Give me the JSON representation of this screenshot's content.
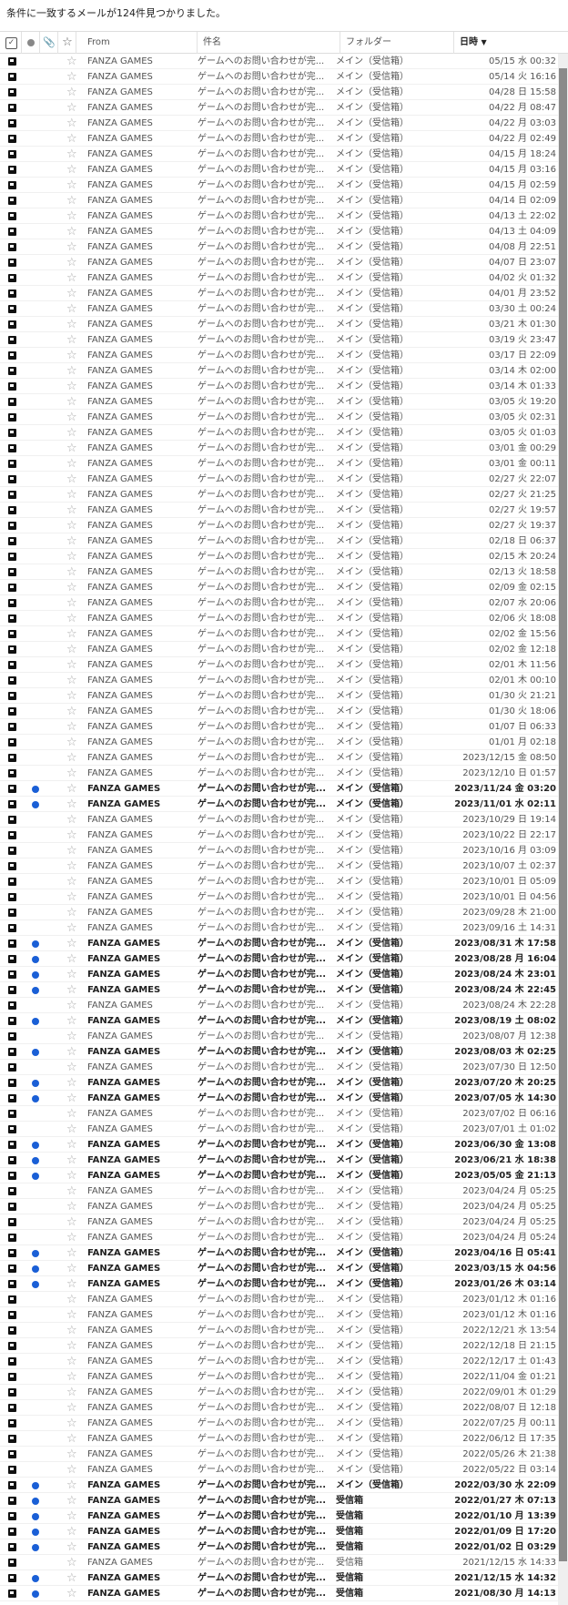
{
  "summary": "条件に一致するメールが124件見つかりました。",
  "header": {
    "select_icon": "checkbox-icon",
    "unread_icon": "unread-dot-icon",
    "attach_icon": "paperclip-icon",
    "star_icon": "star-icon",
    "from": "From",
    "subject": "件名",
    "folder": "フォルダー",
    "date": "日時",
    "sort_indicator": "▼"
  },
  "colors": {
    "unread_dot": "#1a5fd6",
    "flag": "#111111",
    "scrollbar_thumb": "#8a8a8a"
  },
  "rows": [
    {
      "from": "FANZA GAMES",
      "subject": "ゲームへのお問い合わせが完...",
      "folder": "メイン（受信箱）",
      "date": "05/15 水 00:32",
      "unread": false
    },
    {
      "from": "FANZA GAMES",
      "subject": "ゲームへのお問い合わせが完...",
      "folder": "メイン（受信箱）",
      "date": "05/14 火 16:16",
      "unread": false
    },
    {
      "from": "FANZA GAMES",
      "subject": "ゲームへのお問い合わせが完...",
      "folder": "メイン（受信箱）",
      "date": "04/28 日 15:58",
      "unread": false
    },
    {
      "from": "FANZA GAMES",
      "subject": "ゲームへのお問い合わせが完...",
      "folder": "メイン（受信箱）",
      "date": "04/22 月 08:47",
      "unread": false
    },
    {
      "from": "FANZA GAMES",
      "subject": "ゲームへのお問い合わせが完...",
      "folder": "メイン（受信箱）",
      "date": "04/22 月 03:03",
      "unread": false
    },
    {
      "from": "FANZA GAMES",
      "subject": "ゲームへのお問い合わせが完...",
      "folder": "メイン（受信箱）",
      "date": "04/22 月 02:49",
      "unread": false
    },
    {
      "from": "FANZA GAMES",
      "subject": "ゲームへのお問い合わせが完...",
      "folder": "メイン（受信箱）",
      "date": "04/15 月 18:24",
      "unread": false
    },
    {
      "from": "FANZA GAMES",
      "subject": "ゲームへのお問い合わせが完...",
      "folder": "メイン（受信箱）",
      "date": "04/15 月 03:16",
      "unread": false
    },
    {
      "from": "FANZA GAMES",
      "subject": "ゲームへのお問い合わせが完...",
      "folder": "メイン（受信箱）",
      "date": "04/15 月 02:59",
      "unread": false
    },
    {
      "from": "FANZA GAMES",
      "subject": "ゲームへのお問い合わせが完...",
      "folder": "メイン（受信箱）",
      "date": "04/14 日 02:09",
      "unread": false
    },
    {
      "from": "FANZA GAMES",
      "subject": "ゲームへのお問い合わせが完...",
      "folder": "メイン（受信箱）",
      "date": "04/13 土 22:02",
      "unread": false
    },
    {
      "from": "FANZA GAMES",
      "subject": "ゲームへのお問い合わせが完...",
      "folder": "メイン（受信箱）",
      "date": "04/13 土 04:09",
      "unread": false
    },
    {
      "from": "FANZA GAMES",
      "subject": "ゲームへのお問い合わせが完...",
      "folder": "メイン（受信箱）",
      "date": "04/08 月 22:51",
      "unread": false
    },
    {
      "from": "FANZA GAMES",
      "subject": "ゲームへのお問い合わせが完...",
      "folder": "メイン（受信箱）",
      "date": "04/07 日 23:07",
      "unread": false
    },
    {
      "from": "FANZA GAMES",
      "subject": "ゲームへのお問い合わせが完...",
      "folder": "メイン（受信箱）",
      "date": "04/02 火 01:32",
      "unread": false
    },
    {
      "from": "FANZA GAMES",
      "subject": "ゲームへのお問い合わせが完...",
      "folder": "メイン（受信箱）",
      "date": "04/01 月 23:52",
      "unread": false
    },
    {
      "from": "FANZA GAMES",
      "subject": "ゲームへのお問い合わせが完...",
      "folder": "メイン（受信箱）",
      "date": "03/30 土 00:24",
      "unread": false
    },
    {
      "from": "FANZA GAMES",
      "subject": "ゲームへのお問い合わせが完...",
      "folder": "メイン（受信箱）",
      "date": "03/21 木 01:30",
      "unread": false
    },
    {
      "from": "FANZA GAMES",
      "subject": "ゲームへのお問い合わせが完...",
      "folder": "メイン（受信箱）",
      "date": "03/19 火 23:47",
      "unread": false
    },
    {
      "from": "FANZA GAMES",
      "subject": "ゲームへのお問い合わせが完...",
      "folder": "メイン（受信箱）",
      "date": "03/17 日 22:09",
      "unread": false
    },
    {
      "from": "FANZA GAMES",
      "subject": "ゲームへのお問い合わせが完...",
      "folder": "メイン（受信箱）",
      "date": "03/14 木 02:00",
      "unread": false
    },
    {
      "from": "FANZA GAMES",
      "subject": "ゲームへのお問い合わせが完...",
      "folder": "メイン（受信箱）",
      "date": "03/14 木 01:33",
      "unread": false
    },
    {
      "from": "FANZA GAMES",
      "subject": "ゲームへのお問い合わせが完...",
      "folder": "メイン（受信箱）",
      "date": "03/05 火 19:20",
      "unread": false
    },
    {
      "from": "FANZA GAMES",
      "subject": "ゲームへのお問い合わせが完...",
      "folder": "メイン（受信箱）",
      "date": "03/05 火 02:31",
      "unread": false
    },
    {
      "from": "FANZA GAMES",
      "subject": "ゲームへのお問い合わせが完...",
      "folder": "メイン（受信箱）",
      "date": "03/05 火 01:03",
      "unread": false
    },
    {
      "from": "FANZA GAMES",
      "subject": "ゲームへのお問い合わせが完...",
      "folder": "メイン（受信箱）",
      "date": "03/01 金 00:29",
      "unread": false
    },
    {
      "from": "FANZA GAMES",
      "subject": "ゲームへのお問い合わせが完...",
      "folder": "メイン（受信箱）",
      "date": "03/01 金 00:11",
      "unread": false
    },
    {
      "from": "FANZA GAMES",
      "subject": "ゲームへのお問い合わせが完...",
      "folder": "メイン（受信箱）",
      "date": "02/27 火 22:07",
      "unread": false
    },
    {
      "from": "FANZA GAMES",
      "subject": "ゲームへのお問い合わせが完...",
      "folder": "メイン（受信箱）",
      "date": "02/27 火 21:25",
      "unread": false
    },
    {
      "from": "FANZA GAMES",
      "subject": "ゲームへのお問い合わせが完...",
      "folder": "メイン（受信箱）",
      "date": "02/27 火 19:57",
      "unread": false
    },
    {
      "from": "FANZA GAMES",
      "subject": "ゲームへのお問い合わせが完...",
      "folder": "メイン（受信箱）",
      "date": "02/27 火 19:37",
      "unread": false
    },
    {
      "from": "FANZA GAMES",
      "subject": "ゲームへのお問い合わせが完...",
      "folder": "メイン（受信箱）",
      "date": "02/18 日 06:37",
      "unread": false
    },
    {
      "from": "FANZA GAMES",
      "subject": "ゲームへのお問い合わせが完...",
      "folder": "メイン（受信箱）",
      "date": "02/15 木 20:24",
      "unread": false
    },
    {
      "from": "FANZA GAMES",
      "subject": "ゲームへのお問い合わせが完...",
      "folder": "メイン（受信箱）",
      "date": "02/13 火 18:58",
      "unread": false
    },
    {
      "from": "FANZA GAMES",
      "subject": "ゲームへのお問い合わせが完...",
      "folder": "メイン（受信箱）",
      "date": "02/09 金 02:15",
      "unread": false
    },
    {
      "from": "FANZA GAMES",
      "subject": "ゲームへのお問い合わせが完...",
      "folder": "メイン（受信箱）",
      "date": "02/07 水 20:06",
      "unread": false
    },
    {
      "from": "FANZA GAMES",
      "subject": "ゲームへのお問い合わせが完...",
      "folder": "メイン（受信箱）",
      "date": "02/06 火 18:08",
      "unread": false
    },
    {
      "from": "FANZA GAMES",
      "subject": "ゲームへのお問い合わせが完...",
      "folder": "メイン（受信箱）",
      "date": "02/02 金 15:56",
      "unread": false
    },
    {
      "from": "FANZA GAMES",
      "subject": "ゲームへのお問い合わせが完...",
      "folder": "メイン（受信箱）",
      "date": "02/02 金 12:18",
      "unread": false
    },
    {
      "from": "FANZA GAMES",
      "subject": "ゲームへのお問い合わせが完...",
      "folder": "メイン（受信箱）",
      "date": "02/01 木 11:56",
      "unread": false
    },
    {
      "from": "FANZA GAMES",
      "subject": "ゲームへのお問い合わせが完...",
      "folder": "メイン（受信箱）",
      "date": "02/01 木 00:10",
      "unread": false
    },
    {
      "from": "FANZA GAMES",
      "subject": "ゲームへのお問い合わせが完...",
      "folder": "メイン（受信箱）",
      "date": "01/30 火 21:21",
      "unread": false
    },
    {
      "from": "FANZA GAMES",
      "subject": "ゲームへのお問い合わせが完...",
      "folder": "メイン（受信箱）",
      "date": "01/30 火 18:06",
      "unread": false
    },
    {
      "from": "FANZA GAMES",
      "subject": "ゲームへのお問い合わせが完...",
      "folder": "メイン（受信箱）",
      "date": "01/07 日 06:33",
      "unread": false
    },
    {
      "from": "FANZA GAMES",
      "subject": "ゲームへのお問い合わせが完...",
      "folder": "メイン（受信箱）",
      "date": "01/01 月 02:18",
      "unread": false
    },
    {
      "from": "FANZA GAMES",
      "subject": "ゲームへのお問い合わせが完...",
      "folder": "メイン（受信箱）",
      "date": "2023/12/15 金 08:50",
      "unread": false
    },
    {
      "from": "FANZA GAMES",
      "subject": "ゲームへのお問い合わせが完...",
      "folder": "メイン（受信箱）",
      "date": "2023/12/10 日 01:57",
      "unread": false
    },
    {
      "from": "FANZA GAMES",
      "subject": "ゲームへのお問い合わせが完...",
      "folder": "メイン（受信箱）",
      "date": "2023/11/24 金 03:20",
      "unread": true
    },
    {
      "from": "FANZA GAMES",
      "subject": "ゲームへのお問い合わせが完...",
      "folder": "メイン（受信箱）",
      "date": "2023/11/01 水 02:11",
      "unread": true
    },
    {
      "from": "FANZA GAMES",
      "subject": "ゲームへのお問い合わせが完...",
      "folder": "メイン（受信箱）",
      "date": "2023/10/29 日 19:14",
      "unread": false
    },
    {
      "from": "FANZA GAMES",
      "subject": "ゲームへのお問い合わせが完...",
      "folder": "メイン（受信箱）",
      "date": "2023/10/22 日 22:17",
      "unread": false
    },
    {
      "from": "FANZA GAMES",
      "subject": "ゲームへのお問い合わせが完...",
      "folder": "メイン（受信箱）",
      "date": "2023/10/16 月 03:09",
      "unread": false
    },
    {
      "from": "FANZA GAMES",
      "subject": "ゲームへのお問い合わせが完...",
      "folder": "メイン（受信箱）",
      "date": "2023/10/07 土 02:37",
      "unread": false
    },
    {
      "from": "FANZA GAMES",
      "subject": "ゲームへのお問い合わせが完...",
      "folder": "メイン（受信箱）",
      "date": "2023/10/01 日 05:09",
      "unread": false
    },
    {
      "from": "FANZA GAMES",
      "subject": "ゲームへのお問い合わせが完...",
      "folder": "メイン（受信箱）",
      "date": "2023/10/01 日 04:56",
      "unread": false
    },
    {
      "from": "FANZA GAMES",
      "subject": "ゲームへのお問い合わせが完...",
      "folder": "メイン（受信箱）",
      "date": "2023/09/28 木 21:00",
      "unread": false
    },
    {
      "from": "FANZA GAMES",
      "subject": "ゲームへのお問い合わせが完...",
      "folder": "メイン（受信箱）",
      "date": "2023/09/16 土 14:31",
      "unread": false
    },
    {
      "from": "FANZA GAMES",
      "subject": "ゲームへのお問い合わせが完...",
      "folder": "メイン（受信箱）",
      "date": "2023/08/31 木 17:58",
      "unread": true
    },
    {
      "from": "FANZA GAMES",
      "subject": "ゲームへのお問い合わせが完...",
      "folder": "メイン（受信箱）",
      "date": "2023/08/28 月 16:04",
      "unread": true
    },
    {
      "from": "FANZA GAMES",
      "subject": "ゲームへのお問い合わせが完...",
      "folder": "メイン（受信箱）",
      "date": "2023/08/24 木 23:01",
      "unread": true
    },
    {
      "from": "FANZA GAMES",
      "subject": "ゲームへのお問い合わせが完...",
      "folder": "メイン（受信箱）",
      "date": "2023/08/24 木 22:45",
      "unread": true
    },
    {
      "from": "FANZA GAMES",
      "subject": "ゲームへのお問い合わせが完...",
      "folder": "メイン（受信箱）",
      "date": "2023/08/24 木 22:28",
      "unread": false
    },
    {
      "from": "FANZA GAMES",
      "subject": "ゲームへのお問い合わせが完...",
      "folder": "メイン（受信箱）",
      "date": "2023/08/19 土 08:02",
      "unread": true
    },
    {
      "from": "FANZA GAMES",
      "subject": "ゲームへのお問い合わせが完...",
      "folder": "メイン（受信箱）",
      "date": "2023/08/07 月 12:38",
      "unread": false
    },
    {
      "from": "FANZA GAMES",
      "subject": "ゲームへのお問い合わせが完...",
      "folder": "メイン（受信箱）",
      "date": "2023/08/03 木 02:25",
      "unread": true
    },
    {
      "from": "FANZA GAMES",
      "subject": "ゲームへのお問い合わせが完...",
      "folder": "メイン（受信箱）",
      "date": "2023/07/30 日 12:50",
      "unread": false
    },
    {
      "from": "FANZA GAMES",
      "subject": "ゲームへのお問い合わせが完...",
      "folder": "メイン（受信箱）",
      "date": "2023/07/20 木 20:25",
      "unread": true
    },
    {
      "from": "FANZA GAMES",
      "subject": "ゲームへのお問い合わせが完...",
      "folder": "メイン（受信箱）",
      "date": "2023/07/05 水 14:30",
      "unread": true
    },
    {
      "from": "FANZA GAMES",
      "subject": "ゲームへのお問い合わせが完...",
      "folder": "メイン（受信箱）",
      "date": "2023/07/02 日 06:16",
      "unread": false
    },
    {
      "from": "FANZA GAMES",
      "subject": "ゲームへのお問い合わせが完...",
      "folder": "メイン（受信箱）",
      "date": "2023/07/01 土 01:02",
      "unread": false
    },
    {
      "from": "FANZA GAMES",
      "subject": "ゲームへのお問い合わせが完...",
      "folder": "メイン（受信箱）",
      "date": "2023/06/30 金 13:08",
      "unread": true
    },
    {
      "from": "FANZA GAMES",
      "subject": "ゲームへのお問い合わせが完...",
      "folder": "メイン（受信箱）",
      "date": "2023/06/21 水 18:38",
      "unread": true
    },
    {
      "from": "FANZA GAMES",
      "subject": "ゲームへのお問い合わせが完...",
      "folder": "メイン（受信箱）",
      "date": "2023/05/05 金 21:13",
      "unread": true
    },
    {
      "from": "FANZA GAMES",
      "subject": "ゲームへのお問い合わせが完...",
      "folder": "メイン（受信箱）",
      "date": "2023/04/24 月 05:25",
      "unread": false
    },
    {
      "from": "FANZA GAMES",
      "subject": "ゲームへのお問い合わせが完...",
      "folder": "メイン（受信箱）",
      "date": "2023/04/24 月 05:25",
      "unread": false
    },
    {
      "from": "FANZA GAMES",
      "subject": "ゲームへのお問い合わせが完...",
      "folder": "メイン（受信箱）",
      "date": "2023/04/24 月 05:25",
      "unread": false
    },
    {
      "from": "FANZA GAMES",
      "subject": "ゲームへのお問い合わせが完...",
      "folder": "メイン（受信箱）",
      "date": "2023/04/24 月 05:24",
      "unread": false
    },
    {
      "from": "FANZA GAMES",
      "subject": "ゲームへのお問い合わせが完...",
      "folder": "メイン（受信箱）",
      "date": "2023/04/16 日 05:41",
      "unread": true
    },
    {
      "from": "FANZA GAMES",
      "subject": "ゲームへのお問い合わせが完...",
      "folder": "メイン（受信箱）",
      "date": "2023/03/15 水 04:56",
      "unread": true
    },
    {
      "from": "FANZA GAMES",
      "subject": "ゲームへのお問い合わせが完...",
      "folder": "メイン（受信箱）",
      "date": "2023/01/26 木 03:14",
      "unread": true
    },
    {
      "from": "FANZA GAMES",
      "subject": "ゲームへのお問い合わせが完...",
      "folder": "メイン（受信箱）",
      "date": "2023/01/12 木 01:16",
      "unread": false
    },
    {
      "from": "FANZA GAMES",
      "subject": "ゲームへのお問い合わせが完...",
      "folder": "メイン（受信箱）",
      "date": "2023/01/12 木 01:16",
      "unread": false
    },
    {
      "from": "FANZA GAMES",
      "subject": "ゲームへのお問い合わせが完...",
      "folder": "メイン（受信箱）",
      "date": "2022/12/21 水 13:54",
      "unread": false
    },
    {
      "from": "FANZA GAMES",
      "subject": "ゲームへのお問い合わせが完...",
      "folder": "メイン（受信箱）",
      "date": "2022/12/18 日 21:15",
      "unread": false
    },
    {
      "from": "FANZA GAMES",
      "subject": "ゲームへのお問い合わせが完...",
      "folder": "メイン（受信箱）",
      "date": "2022/12/17 土 01:43",
      "unread": false
    },
    {
      "from": "FANZA GAMES",
      "subject": "ゲームへのお問い合わせが完...",
      "folder": "メイン（受信箱）",
      "date": "2022/11/04 金 01:21",
      "unread": false
    },
    {
      "from": "FANZA GAMES",
      "subject": "ゲームへのお問い合わせが完...",
      "folder": "メイン（受信箱）",
      "date": "2022/09/01 木 01:29",
      "unread": false
    },
    {
      "from": "FANZA GAMES",
      "subject": "ゲームへのお問い合わせが完...",
      "folder": "メイン（受信箱）",
      "date": "2022/08/07 日 12:18",
      "unread": false
    },
    {
      "from": "FANZA GAMES",
      "subject": "ゲームへのお問い合わせが完...",
      "folder": "メイン（受信箱）",
      "date": "2022/07/25 月 00:11",
      "unread": false
    },
    {
      "from": "FANZA GAMES",
      "subject": "ゲームへのお問い合わせが完...",
      "folder": "メイン（受信箱）",
      "date": "2022/06/12 日 17:35",
      "unread": false
    },
    {
      "from": "FANZA GAMES",
      "subject": "ゲームへのお問い合わせが完...",
      "folder": "メイン（受信箱）",
      "date": "2022/05/26 木 21:38",
      "unread": false
    },
    {
      "from": "FANZA GAMES",
      "subject": "ゲームへのお問い合わせが完...",
      "folder": "メイン（受信箱）",
      "date": "2022/05/22 日 03:14",
      "unread": false
    },
    {
      "from": "FANZA GAMES",
      "subject": "ゲームへのお問い合わせが完...",
      "folder": "メイン（受信箱）",
      "date": "2022/03/30 水 22:09",
      "unread": true
    },
    {
      "from": "FANZA GAMES",
      "subject": "ゲームへのお問い合わせが完...",
      "folder": "受信箱",
      "date": "2022/01/27 木 07:13",
      "unread": true
    },
    {
      "from": "FANZA GAMES",
      "subject": "ゲームへのお問い合わせが完...",
      "folder": "受信箱",
      "date": "2022/01/10 月 13:39",
      "unread": true
    },
    {
      "from": "FANZA GAMES",
      "subject": "ゲームへのお問い合わせが完...",
      "folder": "受信箱",
      "date": "2022/01/09 日 17:20",
      "unread": true
    },
    {
      "from": "FANZA GAMES",
      "subject": "ゲームへのお問い合わせが完...",
      "folder": "受信箱",
      "date": "2022/01/02 日 03:29",
      "unread": true
    },
    {
      "from": "FANZA GAMES",
      "subject": "ゲームへのお問い合わせが完...",
      "folder": "受信箱",
      "date": "2021/12/15 水 14:33",
      "unread": false
    },
    {
      "from": "FANZA GAMES",
      "subject": "ゲームへのお問い合わせが完...",
      "folder": "受信箱",
      "date": "2021/12/15 水 14:32",
      "unread": true
    },
    {
      "from": "FANZA GAMES",
      "subject": "ゲームへのお問い合わせが完...",
      "folder": "受信箱",
      "date": "2021/08/30 月 14:13",
      "unread": true
    }
  ]
}
